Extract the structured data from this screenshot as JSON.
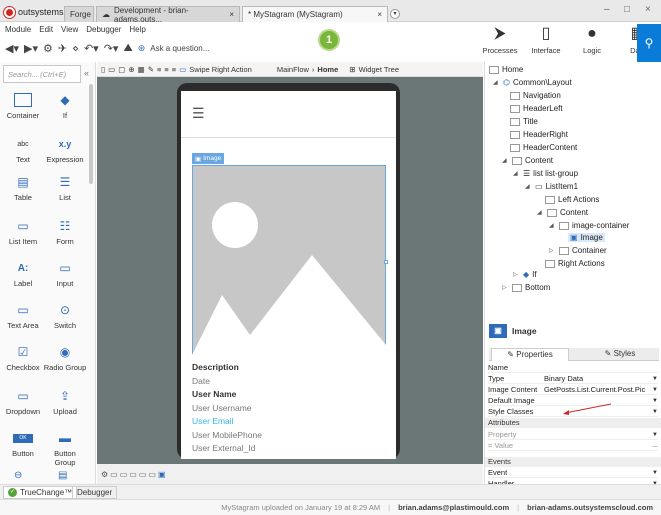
{
  "window": {
    "brand": "outsystems",
    "tabs": [
      {
        "label": "Forge"
      },
      {
        "label": "Development - brian-adams.outs..."
      },
      {
        "label": "* MyStagram (MyStagram)"
      }
    ],
    "controls": {
      "minimize": "–",
      "maximize": "□",
      "close": "×"
    }
  },
  "menu": [
    "Module",
    "Edit",
    "View",
    "Debugger",
    "Help"
  ],
  "toolbar": {
    "ask": "Ask a question...",
    "badge": "1"
  },
  "apps": [
    {
      "label": "Processes",
      "icon": "processes-icon"
    },
    {
      "label": "Interface",
      "icon": "interface-icon"
    },
    {
      "label": "Logic",
      "icon": "logic-icon"
    },
    {
      "label": "Data",
      "icon": "data-icon"
    }
  ],
  "left": {
    "search_placeholder": "Search... (Ctrl+E)",
    "widgets": [
      {
        "label": "Container"
      },
      {
        "label": "If"
      },
      {
        "label": "Text"
      },
      {
        "label": "Expression"
      },
      {
        "label": "Table"
      },
      {
        "label": "List"
      },
      {
        "label": "List Item"
      },
      {
        "label": "Form"
      },
      {
        "label": "Label"
      },
      {
        "label": "Input"
      },
      {
        "label": "Text Area"
      },
      {
        "label": "Switch"
      },
      {
        "label": "Checkbox"
      },
      {
        "label": "Radio Group"
      },
      {
        "label": "Dropdown"
      },
      {
        "label": "Upload"
      },
      {
        "label": "Button"
      },
      {
        "label": "Button Group"
      }
    ],
    "text_icon": "abc",
    "expr_icon": "x.y",
    "label_icon": "A:",
    "button_icon": "OK"
  },
  "canvas": {
    "swipe": "Swipe Right Action",
    "flow": "MainFlow",
    "screen": "Home",
    "widget_tree": "Widget Tree",
    "image_tag": "Image",
    "fields": [
      {
        "text": "Description",
        "style": "bold"
      },
      {
        "text": "Date",
        "style": "muted"
      },
      {
        "text": "User Name",
        "style": "bold"
      },
      {
        "text": "User Username",
        "style": "muted"
      },
      {
        "text": "User Email",
        "style": "link"
      },
      {
        "text": "User MobilePhone",
        "style": "muted"
      },
      {
        "text": "User External_Id",
        "style": "muted"
      }
    ]
  },
  "tree": {
    "nodes": [
      {
        "label": "Home",
        "depth": 0
      },
      {
        "label": "Common\\Layout",
        "depth": 1
      },
      {
        "label": "Navigation",
        "depth": 2
      },
      {
        "label": "HeaderLeft",
        "depth": 2
      },
      {
        "label": "Title",
        "depth": 2
      },
      {
        "label": "HeaderRight",
        "depth": 2
      },
      {
        "label": "HeaderContent",
        "depth": 2
      },
      {
        "label": "Content",
        "depth": 2
      },
      {
        "label": "list list-group",
        "depth": 3
      },
      {
        "label": "ListItem1",
        "depth": 4
      },
      {
        "label": "Left Actions",
        "depth": 5
      },
      {
        "label": "Content",
        "depth": 5
      },
      {
        "label": "image-container",
        "depth": 6
      },
      {
        "label": "Image",
        "depth": 7
      },
      {
        "label": "Container",
        "depth": 6
      },
      {
        "label": "Right Actions",
        "depth": 5
      },
      {
        "label": "If",
        "depth": 3
      },
      {
        "label": "Bottom",
        "depth": 2
      }
    ]
  },
  "props": {
    "title": "Image",
    "tabs": {
      "properties": "Properties",
      "styles": "Styles"
    },
    "rows": [
      {
        "k": "Name",
        "v": ""
      },
      {
        "k": "Type",
        "v": "Binary Data"
      },
      {
        "k": "Image Content",
        "v": "GetPosts.List.Current.Post.Pic"
      },
      {
        "k": "Default Image",
        "v": ""
      },
      {
        "k": "Style Classes",
        "v": ""
      }
    ],
    "attributes": "Attributes",
    "attr_property": "Property",
    "attr_value": "= Value",
    "events": "Events",
    "event_rows": [
      {
        "k": "Event",
        "v": ""
      },
      {
        "k": "Handler",
        "v": ""
      }
    ]
  },
  "bottom": {
    "truechange": "TrueChange™",
    "debugger": "Debugger"
  },
  "status": {
    "message": "MyStagram uploaded on January 19 at 8:29 AM",
    "user": "brian.adams@plastimould.com",
    "server": "brian-adams.outsystemscloud.com"
  }
}
